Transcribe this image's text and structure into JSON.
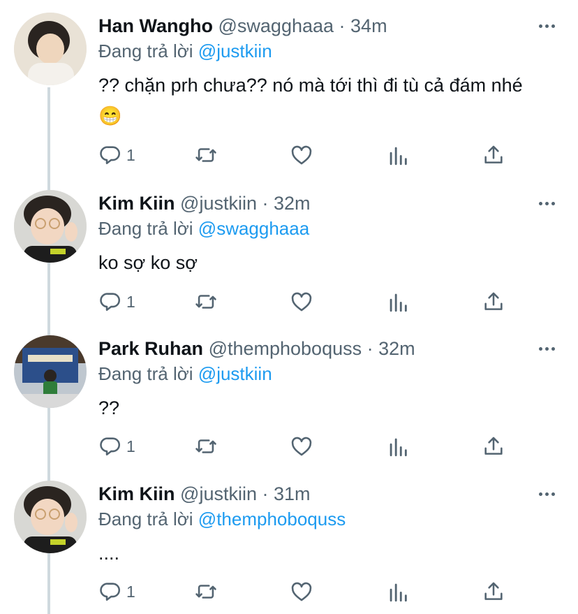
{
  "reply_prefix": "Đang trả lời",
  "tweets": [
    {
      "name": "Han Wangho",
      "handle": "@swagghaaa",
      "time": "· 34m",
      "reply_to": "@justkiin",
      "text": "?? chặn prh chưa??  nó mà tới thì đi tù cả đám nhé 😁",
      "reply_count": "1",
      "avatar": "han-wangho-avatar"
    },
    {
      "name": "Kim Kiin",
      "handle": "@justkiin",
      "time": "· 32m",
      "reply_to": "@swagghaaa",
      "text": "ko sợ ko sợ",
      "reply_count": "1",
      "avatar": "kim-kiin-avatar"
    },
    {
      "name": "Park Ruhan",
      "handle": "@themphoboquss",
      "time": "· 32m",
      "reply_to": "@justkiin",
      "text": "??",
      "reply_count": "1",
      "avatar": "park-ruhan-avatar"
    },
    {
      "name": "Kim Kiin",
      "handle": "@justkiin",
      "time": "· 31m",
      "reply_to": "@themphoboquss",
      "text": "....",
      "reply_count": "1",
      "avatar": "kim-kiin-avatar"
    }
  ],
  "icons": [
    "reply-icon",
    "retweet-icon",
    "like-icon",
    "analytics-icon",
    "share-icon",
    "more-icon"
  ],
  "colors": {
    "mention": "#1d9bf0",
    "secondary": "#536471",
    "text": "#0f1419",
    "thread_line": "#cfd9de"
  }
}
